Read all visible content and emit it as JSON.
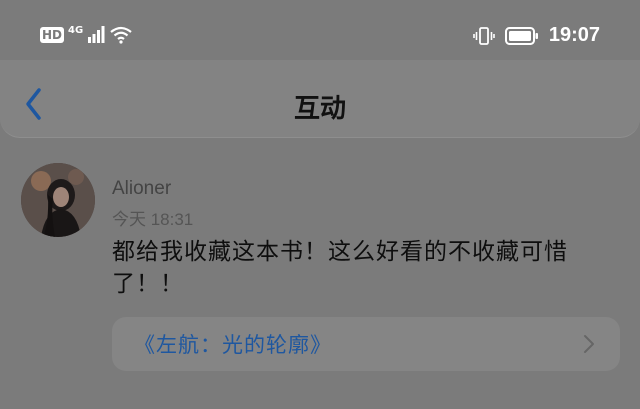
{
  "status_bar": {
    "hd": "HD",
    "network": "4G",
    "time": "19:07",
    "icons": [
      "signal-icon",
      "wifi-icon",
      "vibrate-icon",
      "battery-icon"
    ]
  },
  "nav": {
    "title": "互动",
    "back_icon": "chevron-left-icon"
  },
  "comment": {
    "username": "Alioner",
    "timestamp": "今天 18:31",
    "text": "都给我收藏这本书！这么好看的不收藏可惜了！！",
    "book_title": "《左航：光的轮廓》"
  },
  "colors": {
    "overlay_bg": "#7b7b7b",
    "link": "#1e57a0",
    "back_arrow": "#1e57a0"
  }
}
